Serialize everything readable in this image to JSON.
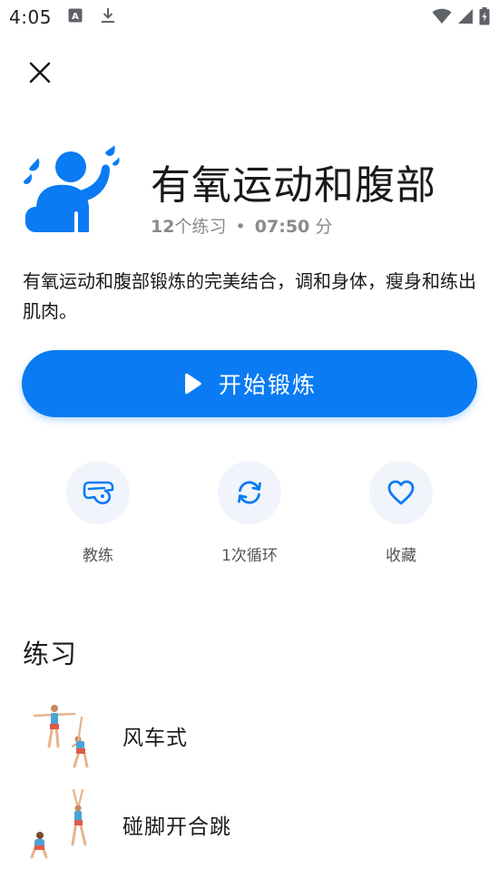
{
  "status_bar": {
    "time": "4:05",
    "icons": [
      "a-notification-icon",
      "download-icon",
      "wifi-icon",
      "signal-icon",
      "battery-icon"
    ]
  },
  "header": {
    "close_icon": "close-icon"
  },
  "workout": {
    "icon": "sweating-person-icon",
    "title": "有氧运动和腹部",
    "meta_count": "12",
    "meta_count_unit": "个练习",
    "meta_dot": "•",
    "meta_duration": "07:50",
    "meta_duration_unit": "分",
    "description": "有氧运动和腹部锻炼的完美结合，调和身体，瘦身和练出肌肉。"
  },
  "start_button": {
    "label": "开始锻炼",
    "icon": "play-icon"
  },
  "actions": [
    {
      "icon": "whistle-icon",
      "label": "教练"
    },
    {
      "icon": "repeat-icon",
      "label": "1次循环"
    },
    {
      "icon": "heart-icon",
      "label": "收藏"
    }
  ],
  "exercises_section": {
    "title": "练习",
    "items": [
      {
        "name": "风车式",
        "thumb": "windmill-exercise-thumbnail"
      },
      {
        "name": "碰脚开合跳",
        "thumb": "toe-touch-jumping-jack-thumbnail"
      }
    ]
  },
  "colors": {
    "accent": "#0a7bf3",
    "action_circle_bg": "#f1f5fb",
    "meta_text": "#8a8a8a"
  }
}
